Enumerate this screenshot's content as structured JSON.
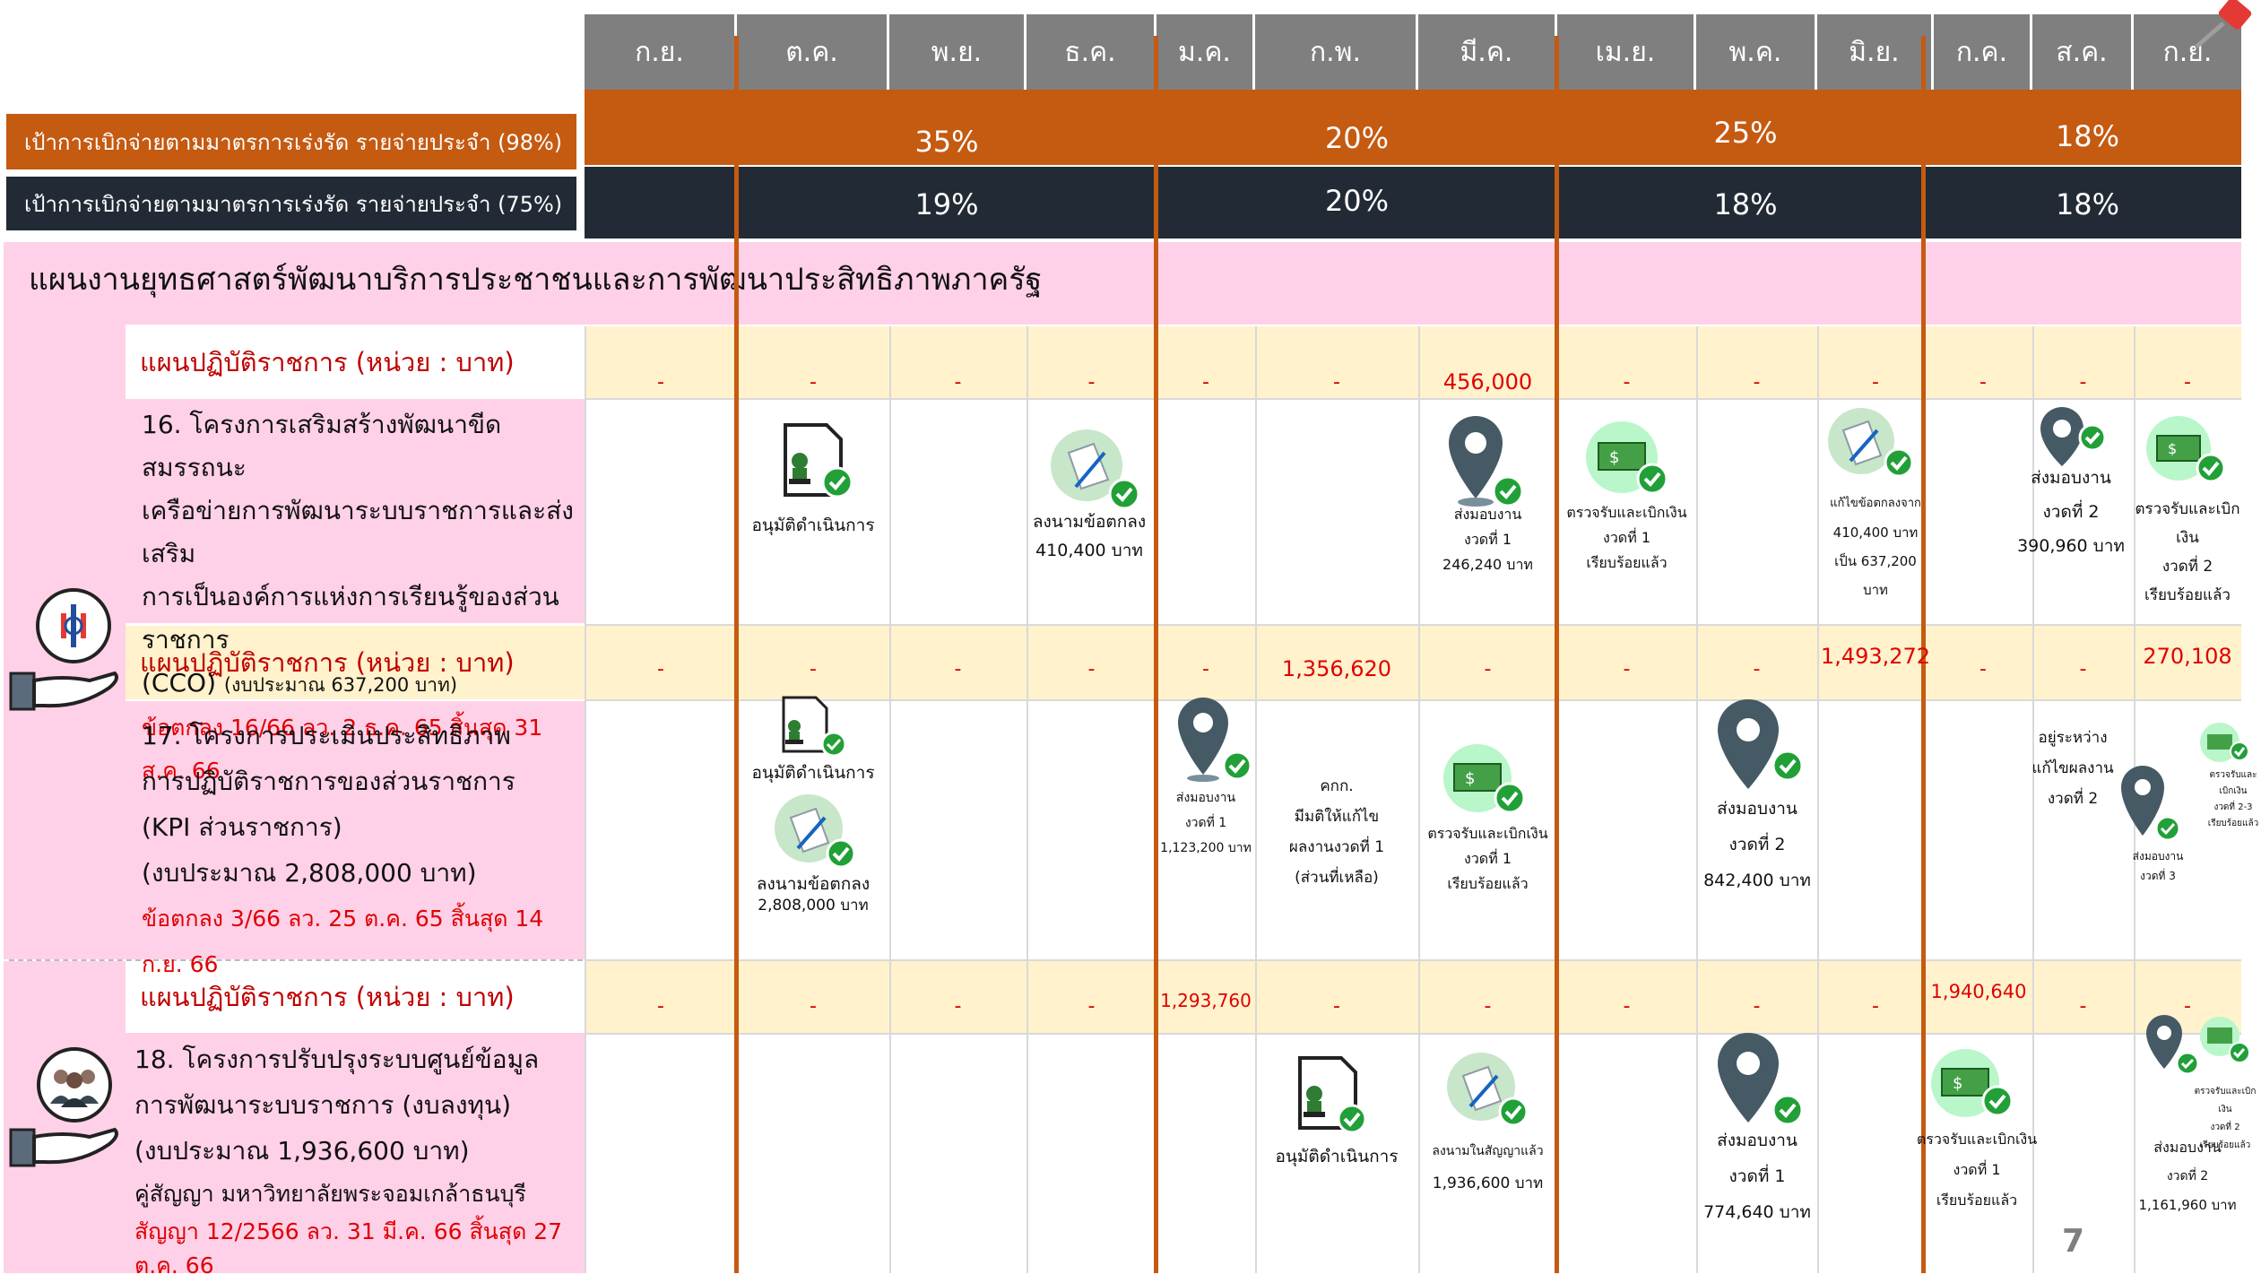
{
  "months": [
    "ก.ย.",
    "ต.ค.",
    "พ.ย.",
    "ธ.ค.",
    "ม.ค.",
    "ก.พ.",
    "มี.ค.",
    "เม.ย.",
    "พ.ค.",
    "มิ.ย.",
    "ก.ค.",
    "ส.ค.",
    "ก.ย."
  ],
  "targets": {
    "row98": {
      "label": "เป้าการเบิกจ่ายตามมาตรการเร่งรัด รายจ่ายประจำ (98%)",
      "q1": "35%",
      "q2": "20%",
      "q3": "25%",
      "q4": "18%"
    },
    "row75": {
      "label": "เป้าการเบิกจ่ายตามมาตรการเร่งรัด รายจ่ายประจำ (75%)",
      "q1": "19%",
      "q2": "20%",
      "q3": "18%",
      "q4": "18%"
    }
  },
  "section_title": "แผนงานยุทธศาสตร์พัฒนาบริการประชาชนและการพัฒนาประสิทธิภาพภาครัฐ",
  "plan_label": "แผนปฏิบัติราชการ (หน่วย : บาท)",
  "dash": "-",
  "project16": {
    "line1": "16. โครงการเสริมสร้างพัฒนาขีดสมรรถนะ",
    "line2": "เครือข่ายการพัฒนาระบบราชการและส่งเสริม",
    "line3": "การเป็นองค์การแห่งการเรียนรู้ของส่วนราชการ",
    "line4a": "(CCO)",
    "line4b": "(งบประมาณ 637,200 บาท)",
    "line5": "ข้อตกลง 16/66 ลว. 2 ธ.ค. 65 สิ้นสุด 31 ส.ค. 66",
    "plan_value_mar": "456,000",
    "oct": "อนุมัติดำเนินการ",
    "dec_1": "ลงนามข้อตกลง",
    "dec_2": "410,400 บาท",
    "mar_1": "ส่งมอบงาน",
    "mar_2": "งวดที่ 1",
    "mar_3": "246,240 บาท",
    "apr_1": "ตรวจรับและเบิกเงิน",
    "apr_2": "งวดที่ 1",
    "apr_3": "เรียบร้อยแล้ว",
    "jun_1": "แก้ไขข้อตกลงจาก",
    "jun_2": "410,400 บาท",
    "jun_3": "เป็น 637,200",
    "jun_4": "บาท",
    "aug_1": "ส่งมอบงาน",
    "aug_2": "งวดที่ 2",
    "aug_3": "390,960 บาท",
    "sep_1": "ตรวจรับและเบิกเงิน",
    "sep_2": "งวดที่ 2",
    "sep_3": "เรียบร้อยแล้ว"
  },
  "project17": {
    "plan_value_feb": "1,356,620",
    "plan_value_jun": "1,493,272",
    "plan_value_sep": "270,108",
    "line1": "17. โครงการประเมินประสิทธิภาพ",
    "line2": "การปฏิบัติราชการของส่วนราชการ",
    "line3": "(KPI ส่วนราชการ)",
    "line4": "(งบประมาณ 2,808,000 บาท)",
    "line5": "ข้อตกลง 3/66 ลว. 25 ต.ค. 65 สิ้นสุด 14 ก.ย. 66",
    "oct_1": "อนุมัติดำเนินการ",
    "oct_2": "ลงนามข้อตกลง",
    "oct_3": "2,808,000 บาท",
    "jan_1": "ส่งมอบงาน",
    "jan_2": "งวดที่ 1",
    "jan_3": "1,123,200 บาท",
    "feb_1": "คกก.",
    "feb_2": "มีมติให้แก้ไข",
    "feb_3": "ผลงานงวดที่ 1",
    "feb_4": "(ส่วนที่เหลือ)",
    "mar_1": "ตรวจรับและเบิกเงิน",
    "mar_2": "งวดที่ 1",
    "mar_3": "เรียบร้อยแล้ว",
    "may_1": "ส่งมอบงาน",
    "may_2": "งวดที่ 2",
    "may_3": "842,400 บาท",
    "aug_1": "อยู่ระหว่าง",
    "aug_2": "แก้ไขผลงาน",
    "aug_3": "งวดที่ 2",
    "sep_a1": "ตรวจรับและเบิกเงิน",
    "sep_a2": "งวดที่ 2-3",
    "sep_a3": "เรียบร้อยแล้ว",
    "sep_b1": "ส่งมอบงาน",
    "sep_b2": "งวดที่ 3"
  },
  "project18": {
    "plan_value_jan": "1,293,760",
    "plan_value_jul": "1,940,640",
    "line1": "18. โครงการปรับปรุงระบบศูนย์ข้อมูล",
    "line2": "การพัฒนาระบบราชการ (งบลงทุน)",
    "line3": "(งบประมาณ 1,936,600 บาท)",
    "line4": "คู่สัญญา มหาวิทยาลัยพระจอมเกล้าธนบุรี",
    "line5": "สัญญา 12/2566 ลว. 31 มี.ค. 66 สิ้นสุด 27 ต.ค. 66",
    "feb": "อนุมัติดำเนินการ",
    "mar_1": "ลงนามในสัญญาแล้ว",
    "mar_2": "1,936,600 บาท",
    "may_1": "ส่งมอบงาน",
    "may_2": "งวดที่ 1",
    "may_3": "774,640 บาท",
    "jul_1": "ตรวจรับและเบิกเงิน",
    "jul_2": "งวดที่ 1",
    "jul_3": "เรียบร้อยแล้ว",
    "sep_a1": "ตรวจรับและเบิกเงิน",
    "sep_a2": "งวดที่ 2",
    "sep_a3": "เรียบร้อยแล้ว",
    "sep_b1": "ส่งมอบงาน",
    "sep_b2": "งวดที่ 2",
    "sep_b3": "1,161,960 บาท"
  },
  "page_number": "7",
  "colors": {
    "header_gray": "#7f7f7f",
    "orange": "#c55a11",
    "dark": "#222b35",
    "pink": "#ffd1e8",
    "cream": "#fff2cc",
    "value_red": "#e00000",
    "check_green": "#21a038"
  }
}
